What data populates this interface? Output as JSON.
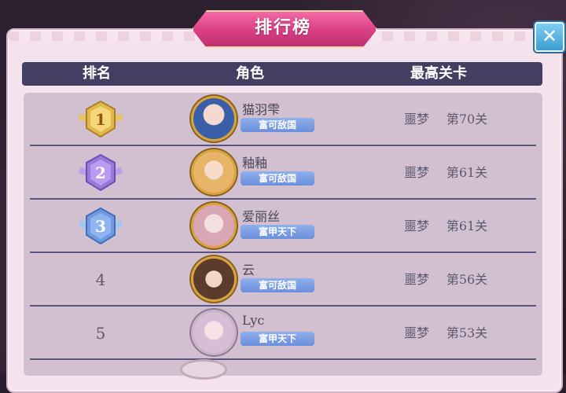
{
  "title": "排行榜",
  "close_label": "✕",
  "header": {
    "rank": "排名",
    "role": "角色",
    "stage": "最高关卡"
  },
  "rows": [
    {
      "rank": "1",
      "name": "猫羽雫",
      "tag": "富可敌国",
      "stage_mode": "噩梦",
      "stage": "第70关",
      "badge_color": "#e0b84c",
      "avatar_bg": "#3b5ea8"
    },
    {
      "rank": "2",
      "name": "釉釉",
      "tag": "富可敌国",
      "stage_mode": "噩梦",
      "stage": "第61关",
      "badge_color": "#9a7ad8",
      "avatar_bg": "#e7b46a"
    },
    {
      "rank": "3",
      "name": "爱丽丝",
      "tag": "富甲天下",
      "stage_mode": "噩梦",
      "stage": "第61关",
      "badge_color": "#6f9ae0",
      "avatar_bg": "#d9a6b8"
    },
    {
      "rank": "4",
      "name": "云",
      "tag": "富可敌国",
      "stage_mode": "噩梦",
      "stage": "第56关",
      "avatar_bg": "#5a3b2c"
    },
    {
      "rank": "5",
      "name": "Lyc",
      "tag": "富甲天下",
      "stage_mode": "噩梦",
      "stage": "第53关",
      "avatar_bg": "#d8bdd6"
    }
  ]
}
